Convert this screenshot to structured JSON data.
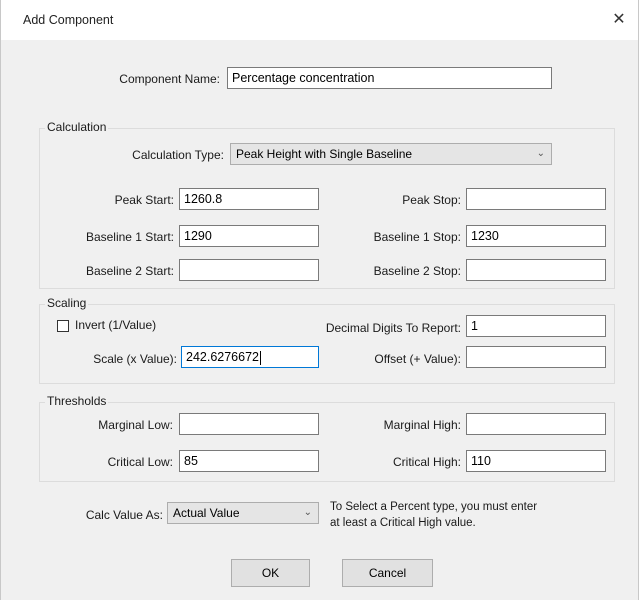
{
  "dialog": {
    "title": "Add Component",
    "close_glyph": "✕"
  },
  "component": {
    "name_label": "Component Name:",
    "name_value": "Percentage concentration"
  },
  "calculation": {
    "group_label": "Calculation",
    "type_label": "Calculation Type:",
    "type_value": "Peak Height with Single Baseline",
    "peak_start_label": "Peak Start:",
    "peak_start_value": "1260.8",
    "peak_stop_label": "Peak Stop:",
    "peak_stop_value": "",
    "baseline1_start_label": "Baseline 1 Start:",
    "baseline1_start_value": "1290",
    "baseline1_stop_label": "Baseline 1 Stop:",
    "baseline1_stop_value": "1230",
    "baseline2_start_label": "Baseline 2 Start:",
    "baseline2_start_value": "",
    "baseline2_stop_label": "Baseline 2 Stop:",
    "baseline2_stop_value": ""
  },
  "scaling": {
    "group_label": "Scaling",
    "invert_label": "Invert (1/Value)",
    "invert_checked": false,
    "decimal_label": "Decimal Digits To Report:",
    "decimal_value": "1",
    "scale_label": "Scale (x Value):",
    "scale_value": "242.6276672",
    "offset_label": "Offset (+ Value):",
    "offset_value": ""
  },
  "thresholds": {
    "group_label": "Thresholds",
    "marginal_low_label": "Marginal Low:",
    "marginal_low_value": "",
    "marginal_high_label": "Marginal High:",
    "marginal_high_value": "",
    "critical_low_label": "Critical Low:",
    "critical_low_value": "85",
    "critical_high_label": "Critical High:",
    "critical_high_value": "110"
  },
  "calc_value": {
    "label": "Calc Value As:",
    "selected": "Actual Value",
    "note_line1": "To Select a Percent type, you must enter",
    "note_line2": "at least a Critical High value."
  },
  "buttons": {
    "ok": "OK",
    "cancel": "Cancel"
  }
}
